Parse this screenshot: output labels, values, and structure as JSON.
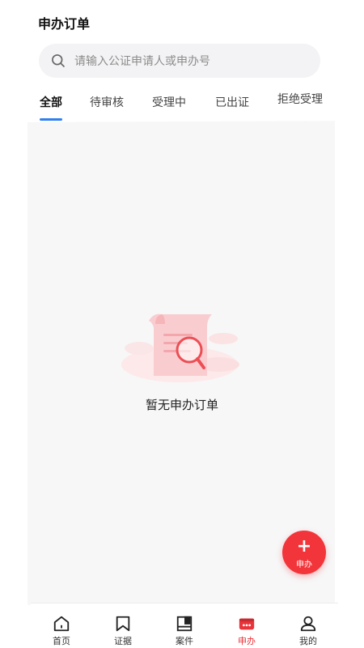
{
  "header": {
    "title": "申办订单"
  },
  "search": {
    "placeholder": "请输入公证申请人或申办号",
    "icon": "search-icon"
  },
  "tabs": [
    {
      "label": "全部",
      "active": true
    },
    {
      "label": "待审核",
      "active": false
    },
    {
      "label": "受理中",
      "active": false
    },
    {
      "label": "已出证",
      "active": false
    },
    {
      "label": "拒绝受理",
      "active": false
    }
  ],
  "empty_state": {
    "message": "暂无申办订单",
    "icon": "document-search-illustration"
  },
  "fab": {
    "label": "申办",
    "icon": "plus-icon",
    "color": "#f2353a"
  },
  "tabbar": {
    "items": [
      {
        "label": "首页",
        "icon": "home-icon",
        "active": false
      },
      {
        "label": "证据",
        "icon": "bookmark-icon",
        "active": false
      },
      {
        "label": "案件",
        "icon": "case-icon",
        "active": false
      },
      {
        "label": "申办",
        "icon": "apply-icon",
        "active": true
      },
      {
        "label": "我的",
        "icon": "person-icon",
        "active": false
      }
    ]
  },
  "colors": {
    "accent": "#2f80ed",
    "brand": "#e8343a"
  }
}
